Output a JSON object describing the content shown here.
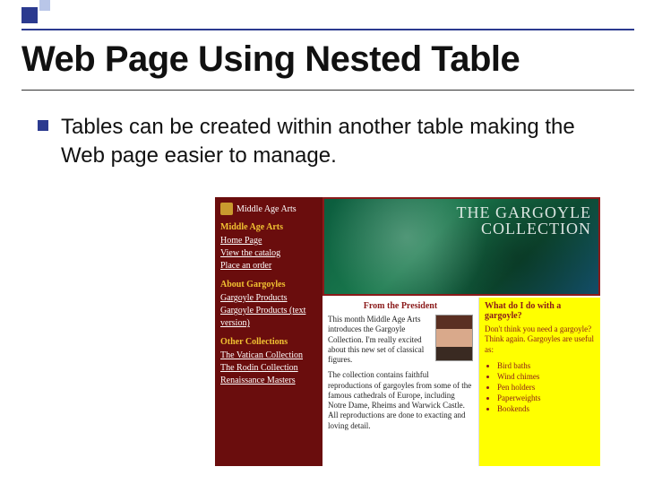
{
  "slide": {
    "title": "Web Page Using Nested Table",
    "bullet": "Tables can be created within another table making the Web page easier to manage."
  },
  "figure": {
    "brand": "Middle Age Arts",
    "sidebar": {
      "section1_heading": "Middle Age Arts",
      "section1_links": [
        "Home Page",
        "View the catalog",
        "Place an order"
      ],
      "section2_heading": "About Gargoyles",
      "section2_links": [
        "Gargoyle Products",
        "Gargoyle Products (text version)"
      ],
      "section3_heading": "Other Collections",
      "section3_links": [
        "The Vatican Collection",
        "The Rodin Collection",
        "Renaissance Masters"
      ]
    },
    "banner": {
      "line1": "THE GARGOYLE",
      "line2": "COLLECTION"
    },
    "middle": {
      "heading": "From the President",
      "para1": "This month Middle Age Arts introduces the Gargoyle Collection. I'm really excited about this new set of classical figures.",
      "para2": "The collection contains faithful reproductions of gargoyles from some of the famous cathedrals of Europe, including Notre Dame, Rheims and Warwick Castle. All reproductions are done to exacting and loving detail."
    },
    "right": {
      "heading": "What do I do with a gargoyle?",
      "lead": "Don't think you need a gargoyle? Think again. Gargoyles are useful as:",
      "items": [
        "Bird baths",
        "Wind chimes",
        "Pen holders",
        "Paperweights",
        "Bookends"
      ]
    }
  }
}
